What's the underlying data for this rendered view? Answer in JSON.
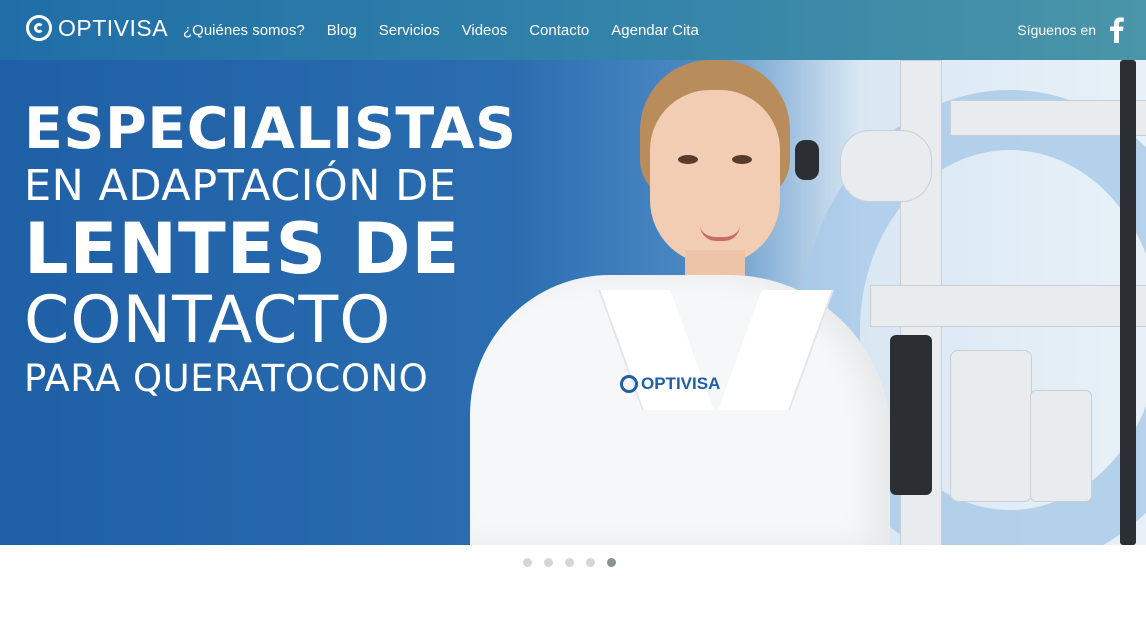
{
  "header": {
    "logo_text": "OPTIVISA",
    "nav": [
      {
        "label": "¿Quiénes somos?"
      },
      {
        "label": "Blog"
      },
      {
        "label": "Servicios"
      },
      {
        "label": "Videos"
      },
      {
        "label": "Contacto"
      },
      {
        "label": "Agendar Cita"
      }
    ],
    "follow_label": "Síguenos en",
    "social_icon": "facebook-icon"
  },
  "hero": {
    "line1": "ESPECIALISTAS",
    "line2": "EN ADAPTACIÓN DE",
    "line3": "LENTES DE",
    "line4": "CONTACTO",
    "line5": "PARA QUERATOCONO",
    "badge_text": "OPTIVISA"
  },
  "carousel": {
    "slides": 5,
    "active_index": 4
  },
  "colors": {
    "brand_blue": "#1e5fa6",
    "nav_start": "#1f6ea8",
    "nav_end": "#4a95a8",
    "dot_inactive": "#d3d6d9",
    "dot_active": "#8c9196"
  }
}
